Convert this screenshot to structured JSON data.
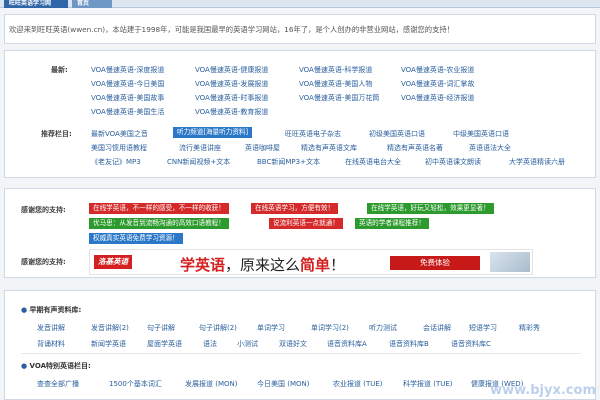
{
  "topbar": {
    "tabs": [
      {
        "label": "旺旺英语学习网"
      },
      {
        "label": "首页"
      }
    ]
  },
  "welcome": {
    "text": "欢迎来到旺旺英语(wwen.cn)，本站建于1998年，可能是我国最早的英语学习网站，16年了，是个人创办的非营业网站，感谢您的支持！"
  },
  "latest": {
    "label": "最新:",
    "links": [
      "VOA慢速英语-深度报道",
      "VOA慢速英语-健康报道",
      "VOA慢速英语-科学报道",
      "VOA慢速英语-农业报道",
      "VOA慢速英语-今日美国",
      "VOA慢速英语-发展报道",
      "VOA慢速英语-美国人物",
      "VOA慢速英语-词汇掌故",
      "VOA慢速英语-美国故事",
      "VOA慢速英语-时事报道",
      "VOA慢速英语-美国万花筒",
      "VOA慢速英语-经济报道",
      "VOA慢速英语-美国生活",
      "VOA慢速英语-教育报道"
    ]
  },
  "recommended": {
    "label": "推荐栏目:",
    "links": [
      "最新VOA美国之音",
      "听力频道[海量听力资料]",
      "旺旺英语电子杂志",
      "初级美国英语口语",
      "中级美国英语口语",
      "美国习惯用语教程",
      "流行美语讲座",
      "英语咖啡屋",
      "精选有声英语文库",
      "精选有声英语名著",
      "英语语法大全",
      "《老友记》MP3",
      "CNN新闻视频+文本",
      "BBC新闻MP3+文本",
      "在线英语电台大全",
      "初中英语课文朗读",
      "大学英语精读六册"
    ]
  },
  "support": {
    "label": "感谢您的支持:",
    "items": [
      "在线学英语，不一样的感受，不一样的收获！",
      "在线英语学习，方便有效！",
      "在线学英语，好玩又轻松，效果更显著！",
      "优马思：从发音到流畅沟通的高效口语教程！",
      "说流利英语一点就通！",
      "英语的学者课程推荐！",
      "权威真实英语免费学习资源！"
    ],
    "banner": {
      "logo": "洛基英语",
      "slogan_prefix": "学英语",
      "slogan_middle": "，原来这么",
      "slogan_emphasis": "简单",
      "slogan_suffix": "！",
      "cta": "免费体验"
    }
  },
  "audio": {
    "title": "早期有声资料库:",
    "links": [
      "发音讲解",
      "发音讲解(2)",
      "句子讲解",
      "句子讲解(2)",
      "单词学习",
      "单词学习(2)",
      "听力测试",
      "会话讲解",
      "短语学习",
      "精彩秀",
      "背诵材料",
      "新闻学英语",
      "屋面学英语",
      "语法",
      "小测试",
      "双语好文",
      "语音资料库A",
      "语音资料库B",
      "语音资料库C"
    ]
  },
  "voa": {
    "title": "VOA特别英语栏目:",
    "links": [
      "查查全部广播",
      "1500个基本词汇",
      "发展报道 (MON)",
      "今日美国 (MON)",
      "农业报道 (TUE)",
      "科学报道 (TUE)",
      "健康报道 (WED)"
    ]
  },
  "watermark": "www.bjyx.com"
}
